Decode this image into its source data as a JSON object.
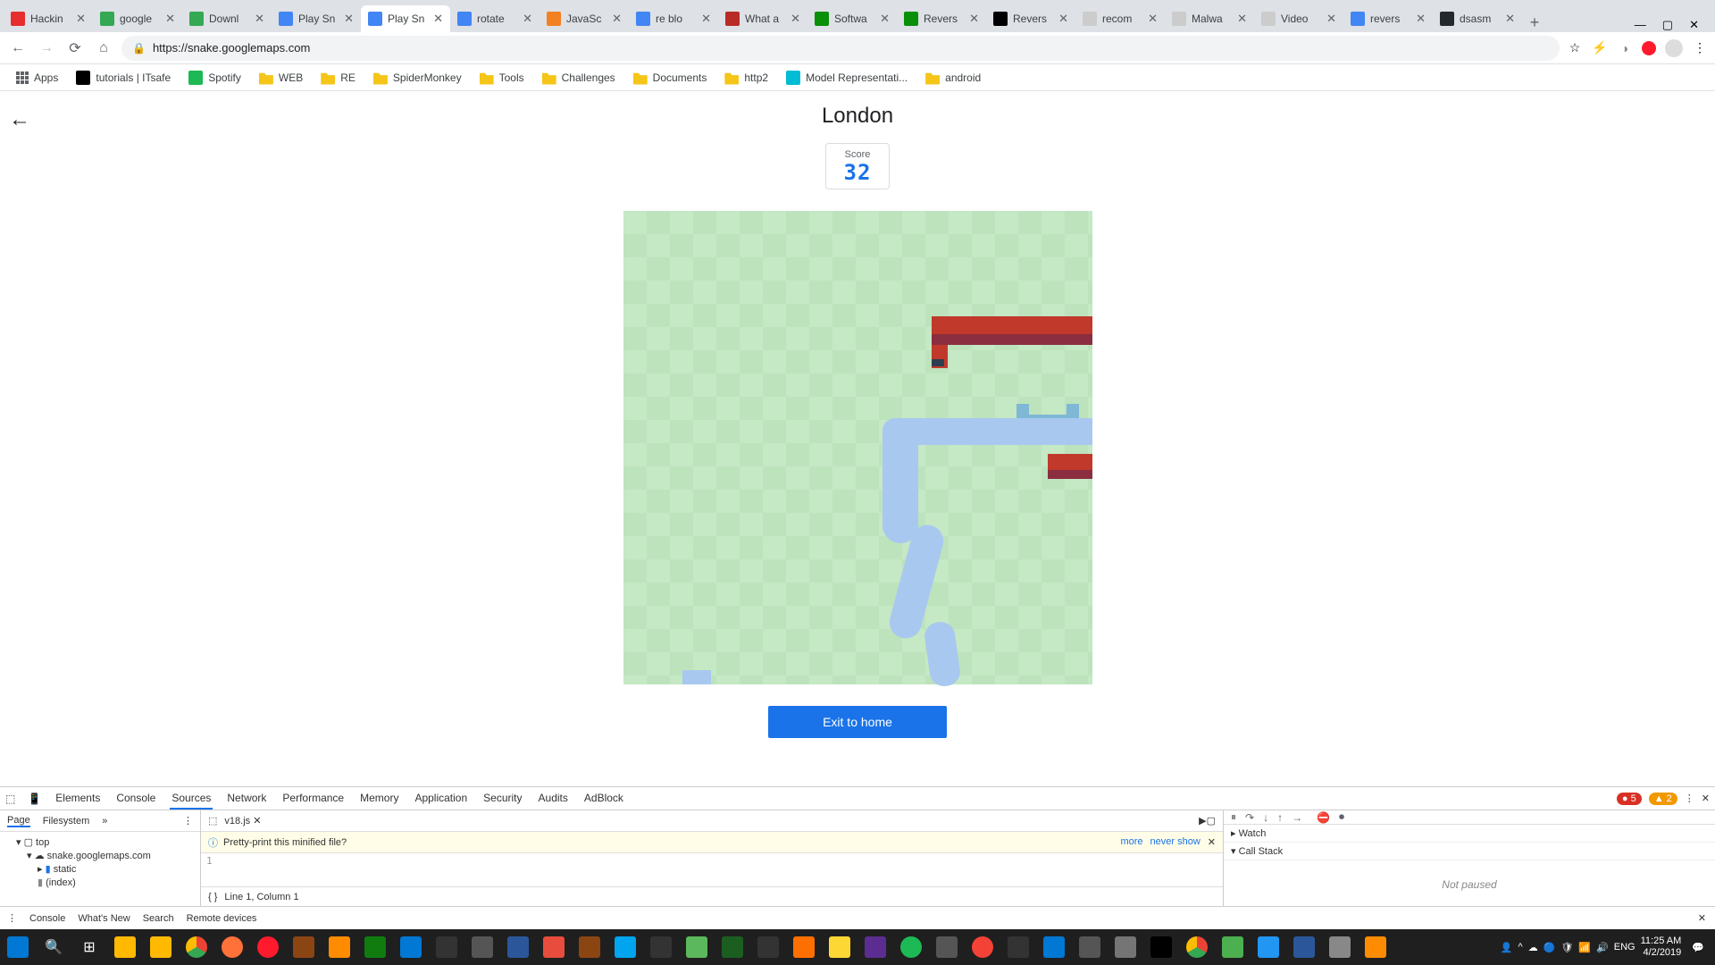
{
  "browser": {
    "tabs": [
      {
        "title": "Hackin",
        "favicon": "#e62e2e"
      },
      {
        "title": "google",
        "favicon": "#34a853"
      },
      {
        "title": "Downl",
        "favicon": "#34a853"
      },
      {
        "title": "Play Sn",
        "favicon": "#4285f4"
      },
      {
        "title": "Play Sn",
        "favicon": "#4285f4",
        "active": true
      },
      {
        "title": "rotate",
        "favicon": "#4285f4"
      },
      {
        "title": "JavaSc",
        "favicon": "#f48024"
      },
      {
        "title": "re blo",
        "favicon": "#4285f4"
      },
      {
        "title": "What a",
        "favicon": "#b92b27"
      },
      {
        "title": "Softwa",
        "favicon": "#0a8f08"
      },
      {
        "title": "Revers",
        "favicon": "#0a8f08"
      },
      {
        "title": "Revers",
        "favicon": "#000000"
      },
      {
        "title": "recom",
        "favicon": "#cccccc"
      },
      {
        "title": "Malwa",
        "favicon": "#cccccc"
      },
      {
        "title": "Video",
        "favicon": "#cccccc"
      },
      {
        "title": "revers",
        "favicon": "#4285f4"
      },
      {
        "title": "dsasm",
        "favicon": "#24292e"
      }
    ],
    "url": "https://snake.googlemaps.com",
    "bookmarks": [
      {
        "label": "Apps",
        "icon": "#5f6368"
      },
      {
        "label": "tutorials | ITsafe",
        "icon": "#000"
      },
      {
        "label": "Spotify",
        "icon": "#1db954"
      },
      {
        "label": "WEB",
        "folder": true
      },
      {
        "label": "RE",
        "folder": true
      },
      {
        "label": "SpiderMonkey",
        "folder": true
      },
      {
        "label": "Tools",
        "folder": true
      },
      {
        "label": "Challenges",
        "folder": true
      },
      {
        "label": "Documents",
        "folder": true
      },
      {
        "label": "http2",
        "folder": true
      },
      {
        "label": "Model Representati...",
        "icon": "#00bcd4"
      },
      {
        "label": "android",
        "folder": true
      }
    ]
  },
  "game": {
    "title": "London",
    "score_label": "Score",
    "score": "32",
    "exit_button": "Exit to home"
  },
  "devtools": {
    "tabs": [
      "Elements",
      "Console",
      "Sources",
      "Network",
      "Performance",
      "Memory",
      "Application",
      "Security",
      "Audits",
      "AdBlock"
    ],
    "active_tab": "Sources",
    "errors": "5",
    "warnings": "2",
    "left_tabs": [
      "Page",
      "Filesystem"
    ],
    "tree": {
      "root": "top",
      "domain": "snake.googlemaps.com",
      "folder": "static",
      "file": "(index)"
    },
    "file_tab": "v18.js",
    "pretty_prompt": "Pretty-print this minified file?",
    "pretty_more": "more",
    "pretty_never": "never show",
    "cursor": "Line 1, Column 1",
    "watch": "Watch",
    "callstack": "Call Stack",
    "paused": "Not paused",
    "console_tabs": [
      "Console",
      "What's New",
      "Search",
      "Remote devices"
    ]
  },
  "system": {
    "lang": "ENG",
    "time": "11:25 AM",
    "date": "4/2/2019"
  }
}
